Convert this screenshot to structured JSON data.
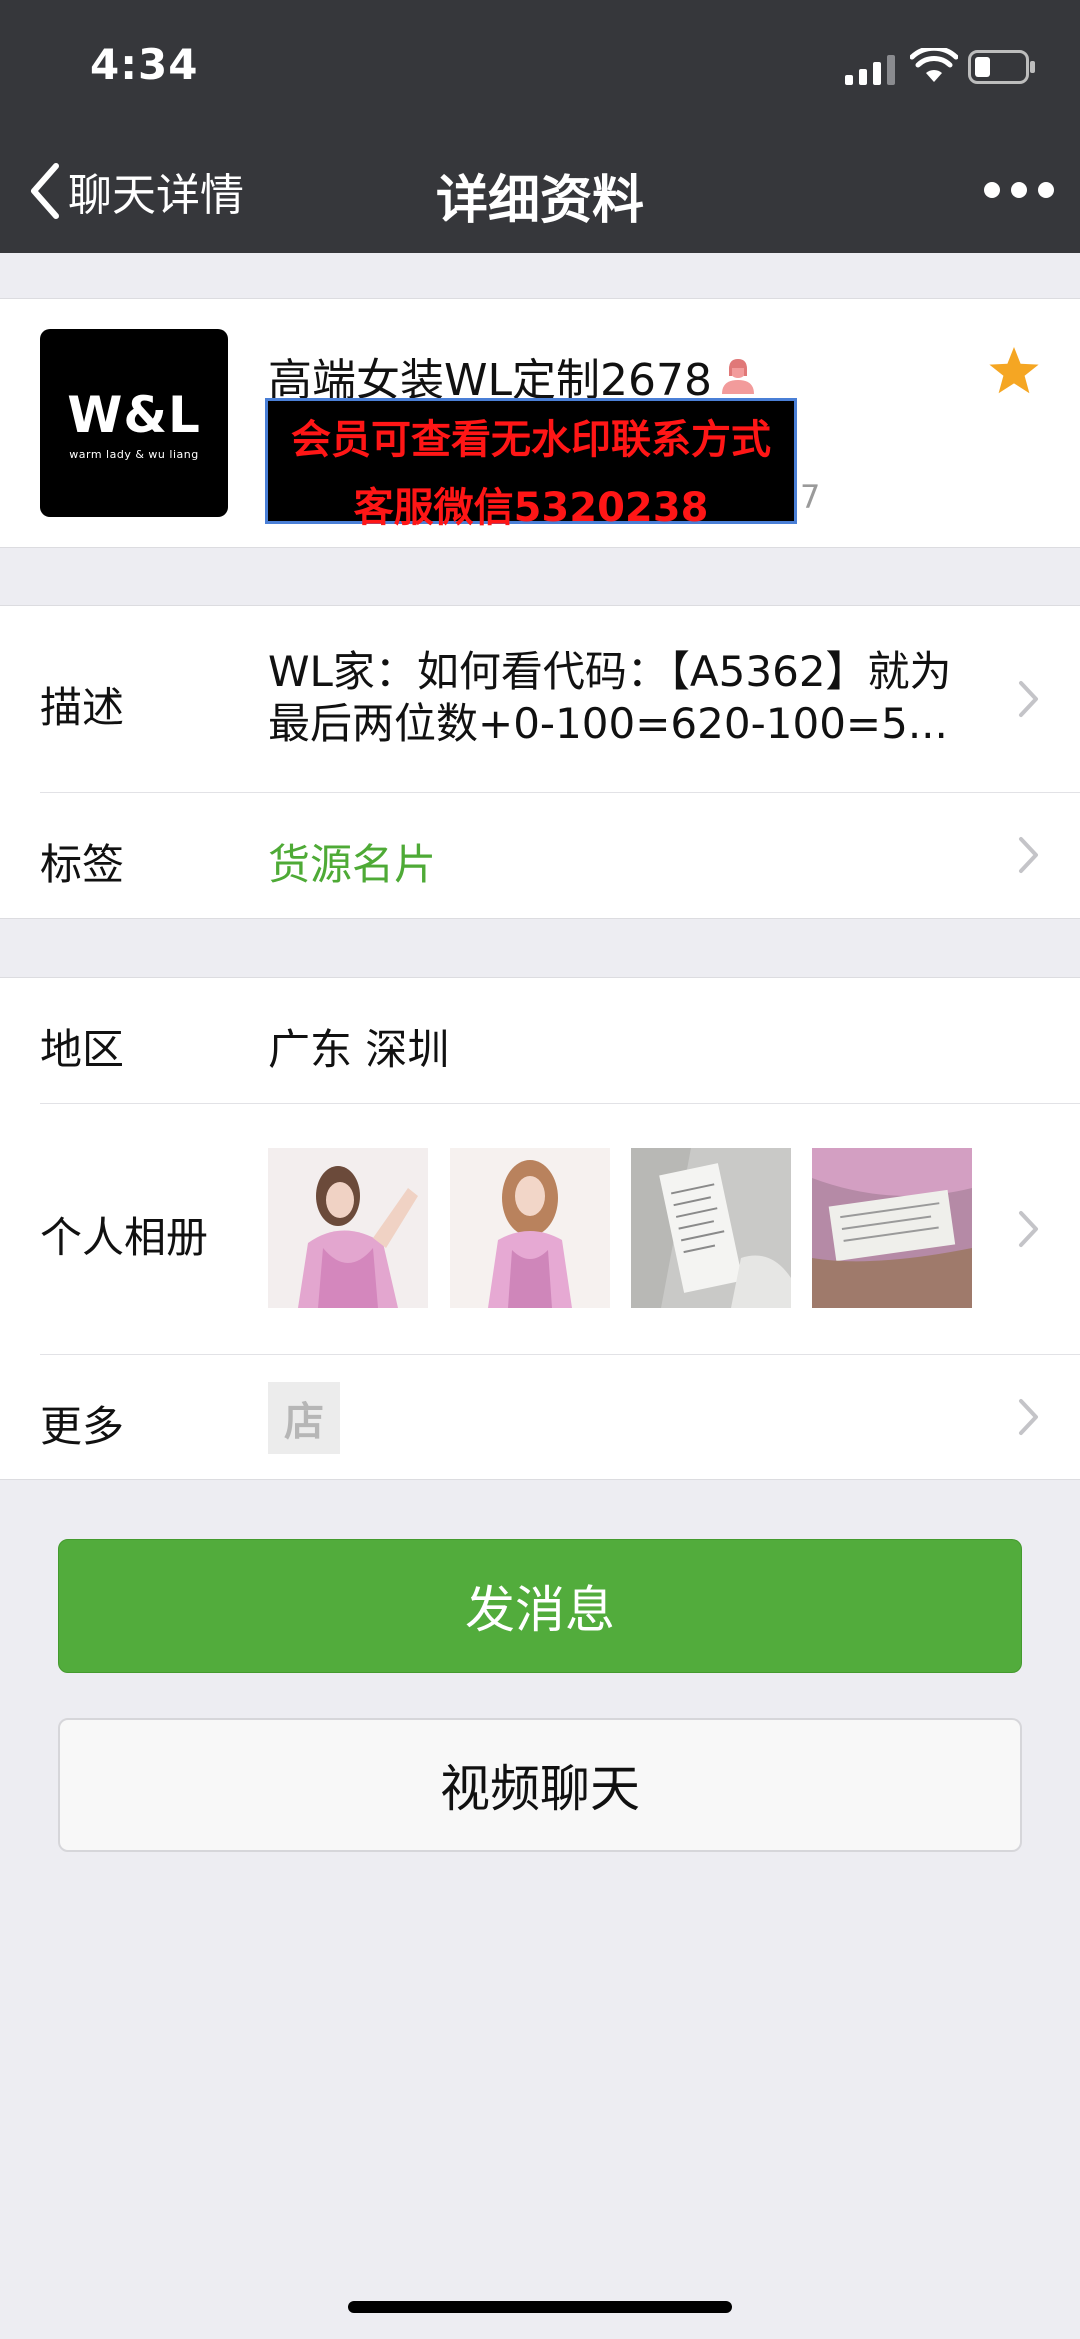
{
  "status_bar": {
    "time": "4:34"
  },
  "nav": {
    "back_label": "聊天详情",
    "title": "详细资料"
  },
  "profile": {
    "avatar_logo": "W&L",
    "avatar_sub": "warm lady & wu liang",
    "name": "高端女装WL定制2678",
    "watermark_line1": "会员可查看无水印联系方式",
    "watermark_line2": "客服微信5320238",
    "id_tail": "7"
  },
  "rows": {
    "description_label": "描述",
    "description_value": "WL家：如何看代码：【A5362】就为最后两位数+0-100=620-100=5...",
    "tags_label": "标签",
    "tags_value": "货源名片",
    "region_label": "地区",
    "region_value": "广东 深圳",
    "album_label": "个人相册",
    "more_label": "更多",
    "shop_glyph": "店"
  },
  "buttons": {
    "send_message": "发消息",
    "video_chat": "视频聊天"
  },
  "colors": {
    "header_bg": "#36373b",
    "accent_green": "#52ac3c",
    "tag_green": "#4eaa36",
    "star": "#f5a623",
    "watermark_red": "#ff1616"
  }
}
